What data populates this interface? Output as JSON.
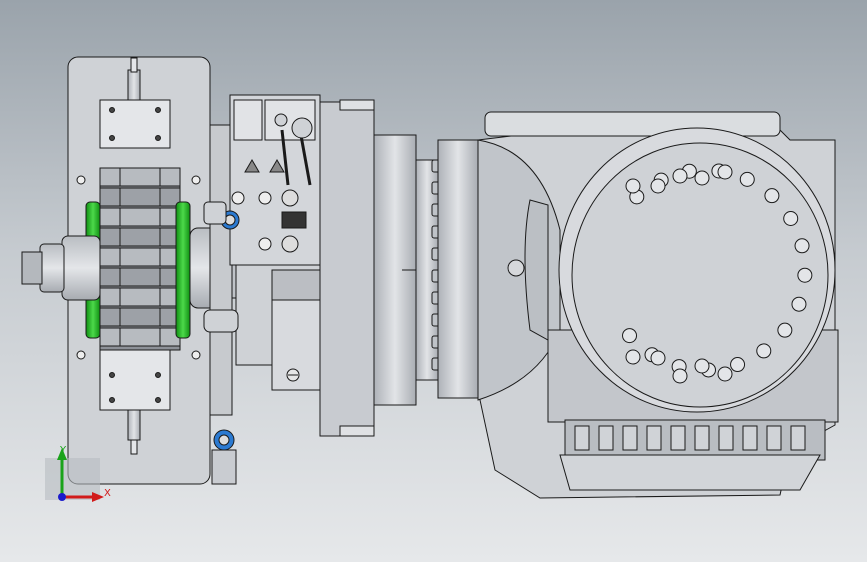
{
  "viewport": {
    "background_top": "#9aa3ab",
    "background_bottom": "#e6e8ea",
    "part_color": "#c9ccd1",
    "edge_color": "#1a1a1a",
    "highlight_color": "#2ec02e"
  },
  "triad": {
    "x_label": "X",
    "y_label": "Y",
    "x_color": "#d11a1a",
    "y_color": "#1aa31a",
    "z_color": "#1a1acc"
  }
}
